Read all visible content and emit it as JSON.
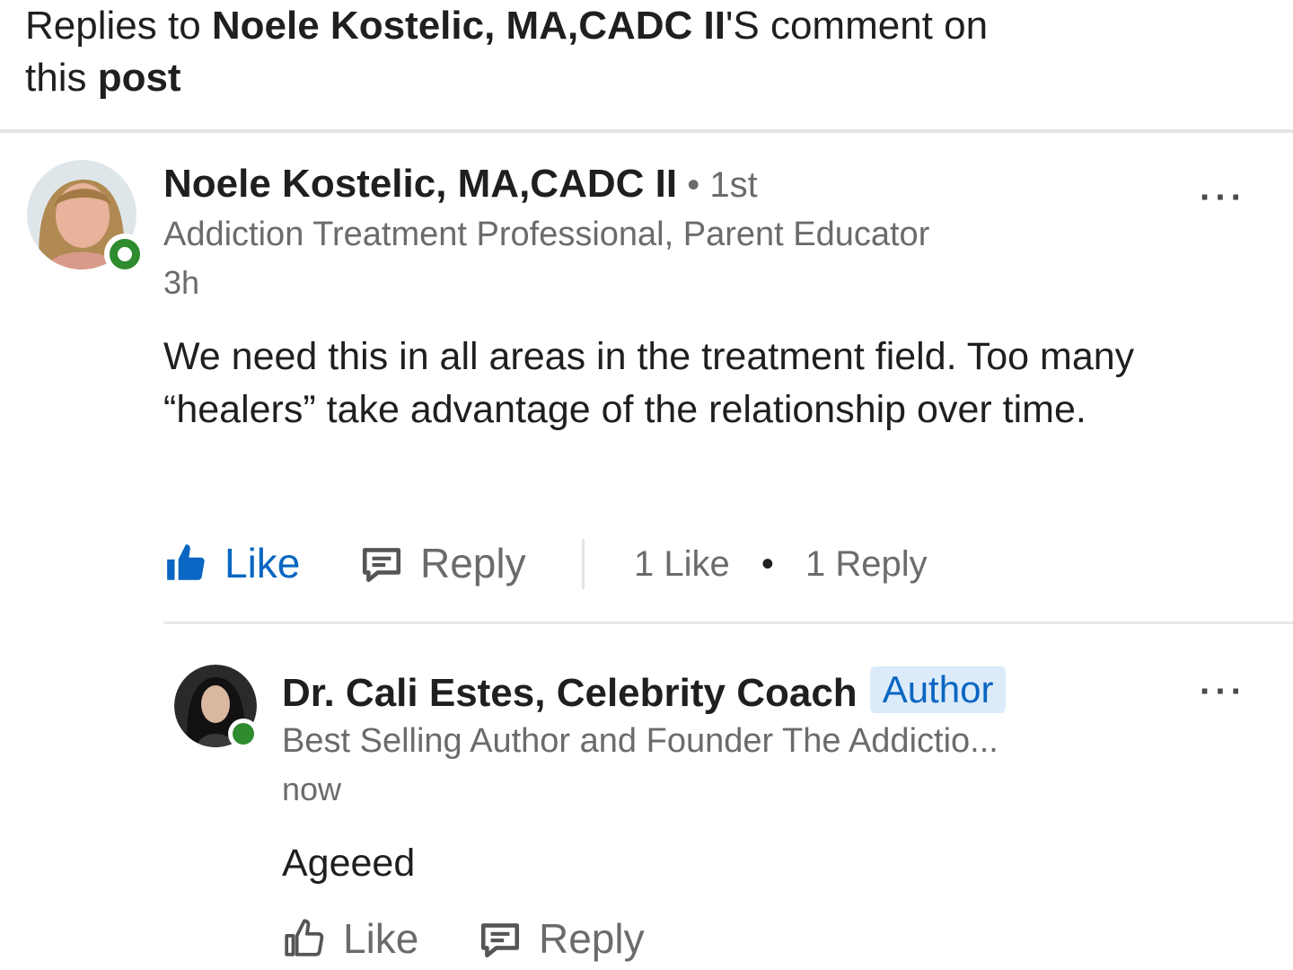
{
  "header": {
    "prefix": "Replies to ",
    "target": "Noele Kostelic, MA,CADC II",
    "suffix": "'S comment on",
    "line2_prefix": "this ",
    "line2_bold": "post"
  },
  "comment": {
    "author": "Noele Kostelic, MA,CADC II",
    "degree": " • 1st",
    "headline": "Addiction Treatment Professional, Parent Educator",
    "time": "3h",
    "text": "We need this in all areas in the treatment field. Too many “healers” take advantage of the relationship over time.",
    "like_label": "Like",
    "reply_label": "Reply",
    "like_count": "1 Like",
    "count_sep": "•",
    "reply_count": "1 Reply",
    "more": "···"
  },
  "reply": {
    "author": "Dr. Cali Estes, Celebrity Coach",
    "badge": "Author",
    "headline": "Best Selling Author and Founder The Addictio...",
    "time": "now",
    "text": "Ageeed",
    "like_label": "Like",
    "reply_label": "Reply",
    "more": "···"
  },
  "colors": {
    "accent": "#0a66c2",
    "presence": "#2e8b2e",
    "muted": "#6b6b6b"
  }
}
